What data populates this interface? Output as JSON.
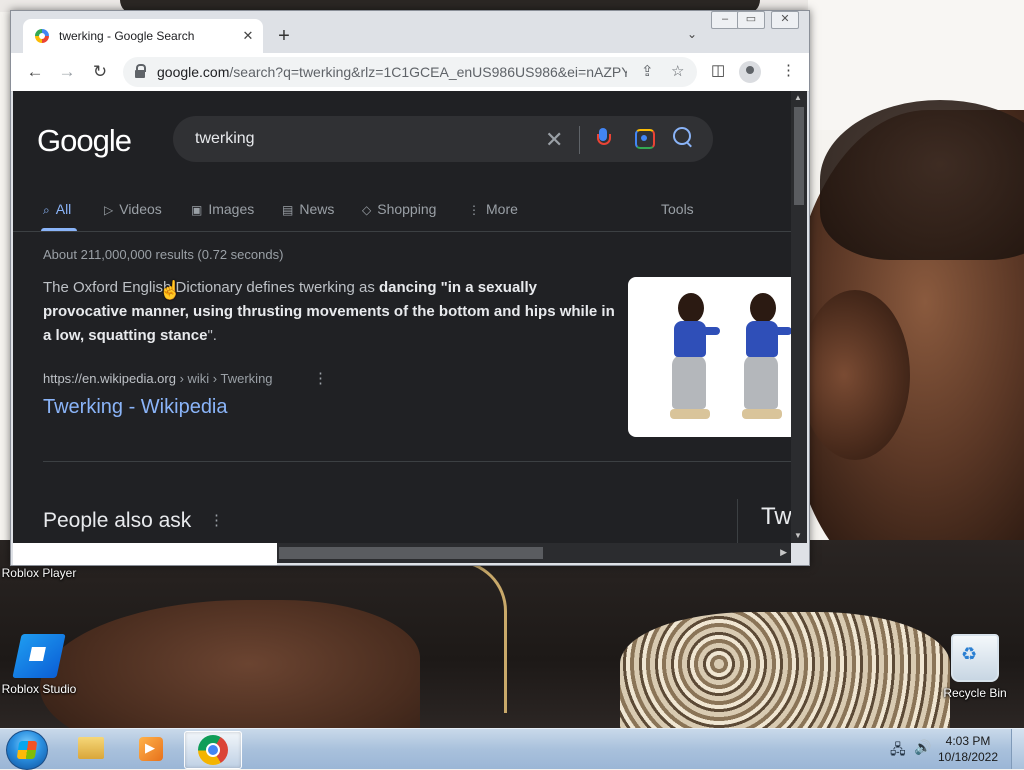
{
  "desktop": {
    "icons": [
      {
        "label": "Roblox Player"
      },
      {
        "label": "Roblox Studio"
      },
      {
        "label": "Recycle Bin"
      }
    ]
  },
  "taskbar": {
    "clock_time": "4:03 PM",
    "clock_date": "10/18/2022"
  },
  "browser": {
    "tab_title": "twerking - Google Search",
    "url_host": "google.com",
    "url_rest": "/search?q=twerking&rlz=1C1GCEA_enUS986US986&ei=nAZPY..."
  },
  "search": {
    "logo": "Google",
    "query": "twerking",
    "tabs": [
      {
        "label": "All",
        "icon": "search-icon"
      },
      {
        "label": "Videos",
        "icon": "video-icon"
      },
      {
        "label": "Images",
        "icon": "image-icon"
      },
      {
        "label": "News",
        "icon": "news-icon"
      },
      {
        "label": "Shopping",
        "icon": "tag-icon"
      },
      {
        "label": "More",
        "icon": "more-vertical-icon"
      }
    ],
    "tools_label": "Tools",
    "stats": "About 211,000,000 results (0.72 seconds)",
    "snippet_plain": "The Oxford English Dictionary defines twerking as ",
    "snippet_bold": "dancing \"in a sexually provocative manner, using thrusting movements of the bottom and hips while in a low, squatting stance",
    "snippet_end": "\".",
    "cite_host": "https://en.wikipedia.org",
    "cite_path": " › wiki › Twerking",
    "result_title": "Twerking - Wikipedia",
    "paa_title": "People also ask",
    "side_panel_title": "Tw"
  },
  "colors": {
    "page_bg": "#202124",
    "link": "#8ab4f8",
    "text": "#bdc1c6"
  }
}
